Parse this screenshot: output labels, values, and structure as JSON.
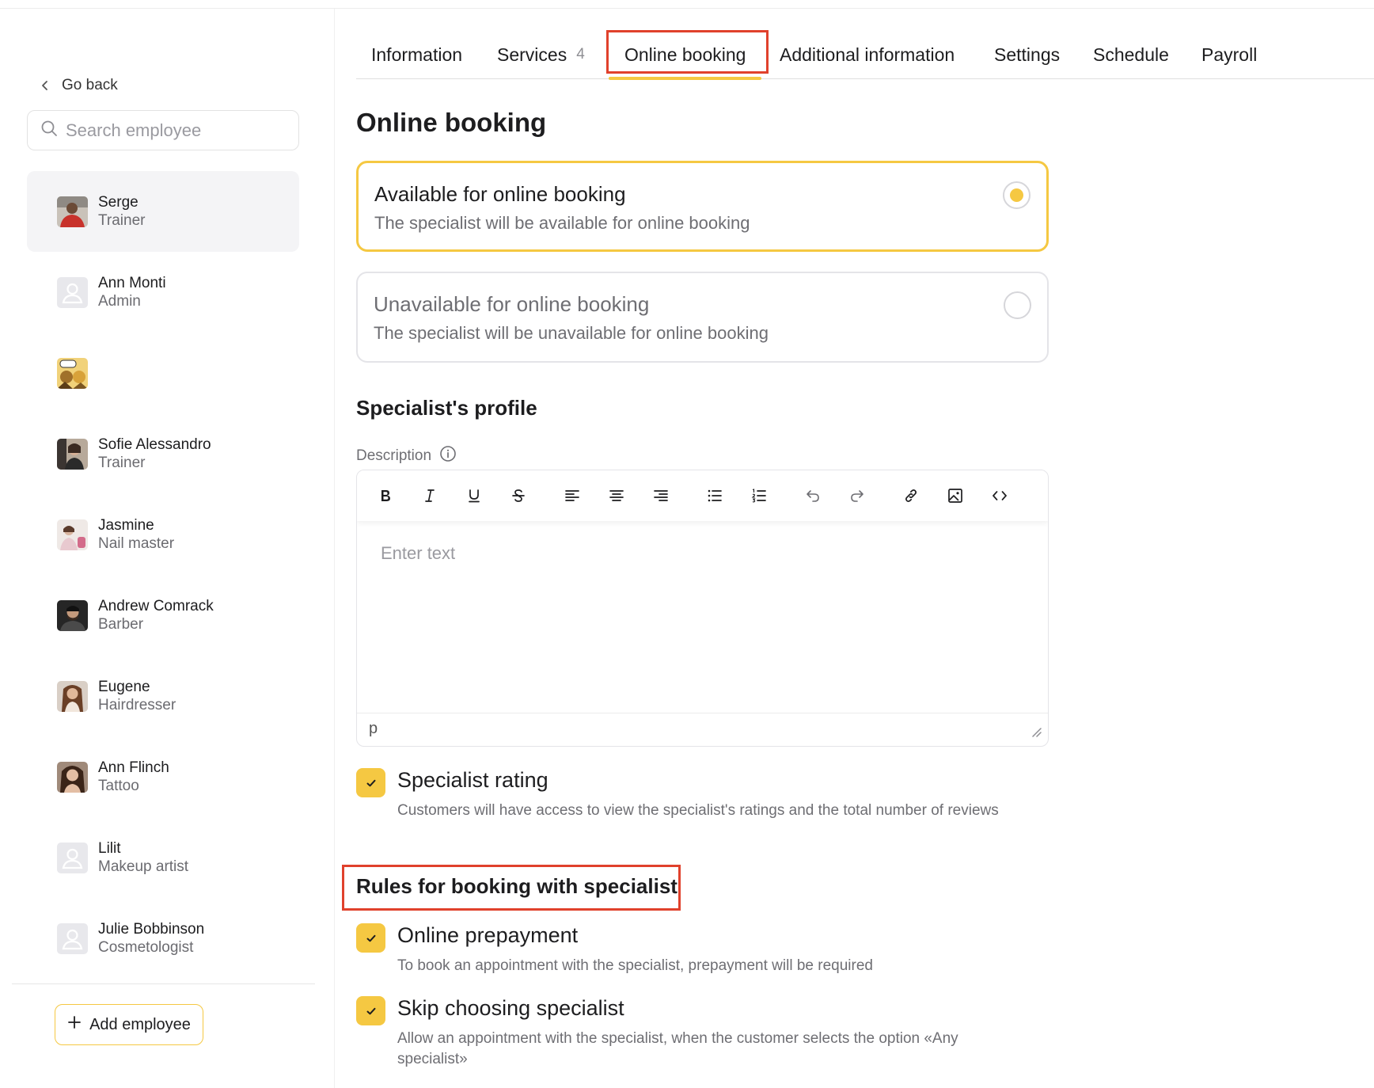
{
  "sidebar": {
    "go_back": "Go back",
    "search_placeholder": "Search employee",
    "employees": [
      {
        "name": "Serge",
        "role": "Trainer",
        "selected": true,
        "avatar": "photo"
      },
      {
        "name": "Ann Monti",
        "role": "Admin",
        "avatar": "placeholder"
      },
      {
        "name": "",
        "role": "",
        "avatar": "comic-photo"
      },
      {
        "name": "Sofie Alessandro",
        "role": "Trainer",
        "avatar": "photo"
      },
      {
        "name": "Jasmine",
        "role": "Nail master",
        "avatar": "photo"
      },
      {
        "name": "Andrew Comrack",
        "role": "Barber",
        "avatar": "photo"
      },
      {
        "name": "Eugene",
        "role": "Hairdresser",
        "avatar": "photo"
      },
      {
        "name": "Ann Flinch",
        "role": "Tattoo",
        "avatar": "photo"
      },
      {
        "name": "Lilit",
        "role": "Makeup artist",
        "avatar": "placeholder"
      },
      {
        "name": "Julie Bobbinson",
        "role": "Cosmetologist",
        "avatar": "placeholder"
      }
    ],
    "add_employee": "Add employee"
  },
  "tabs": [
    {
      "label": "Information"
    },
    {
      "label": "Services",
      "count": "4"
    },
    {
      "label": "Online booking",
      "active": true
    },
    {
      "label": "Additional information"
    },
    {
      "label": "Settings"
    },
    {
      "label": "Schedule"
    },
    {
      "label": "Payroll"
    }
  ],
  "page_title": "Online booking",
  "booking_options": [
    {
      "title": "Available for online booking",
      "description": "The specialist will be available for online booking",
      "selected": true
    },
    {
      "title": "Unavailable for online booking",
      "description": "The specialist will be unavailable for online booking",
      "selected": false
    }
  ],
  "profile": {
    "title": "Specialist's profile",
    "description_label": "Description",
    "editor_placeholder": "Enter text",
    "editor_status": "p",
    "toolbar": [
      "bold-icon",
      "italic-icon",
      "underline-icon",
      "strikethrough-icon",
      "align-left-icon",
      "align-center-icon",
      "align-right-icon",
      "bullet-list-icon",
      "numbered-list-icon",
      "undo-icon",
      "redo-icon",
      "link-icon",
      "image-icon",
      "code-icon"
    ]
  },
  "rating": {
    "title": "Specialist rating",
    "description": "Customers will have access to view the specialist's ratings and the total number of reviews",
    "checked": true
  },
  "rules": {
    "title": "Rules for booking with specialist",
    "items": [
      {
        "title": "Online prepayment",
        "description": "To book an appointment with the specialist, prepayment will be required",
        "checked": true
      },
      {
        "title": "Skip choosing specialist",
        "description": "Allow an appointment with the specialist, when the customer selects the option «Any specialist»",
        "checked": true
      }
    ]
  },
  "colors": {
    "accent": "#f5c842",
    "highlight": "#e0412c"
  }
}
